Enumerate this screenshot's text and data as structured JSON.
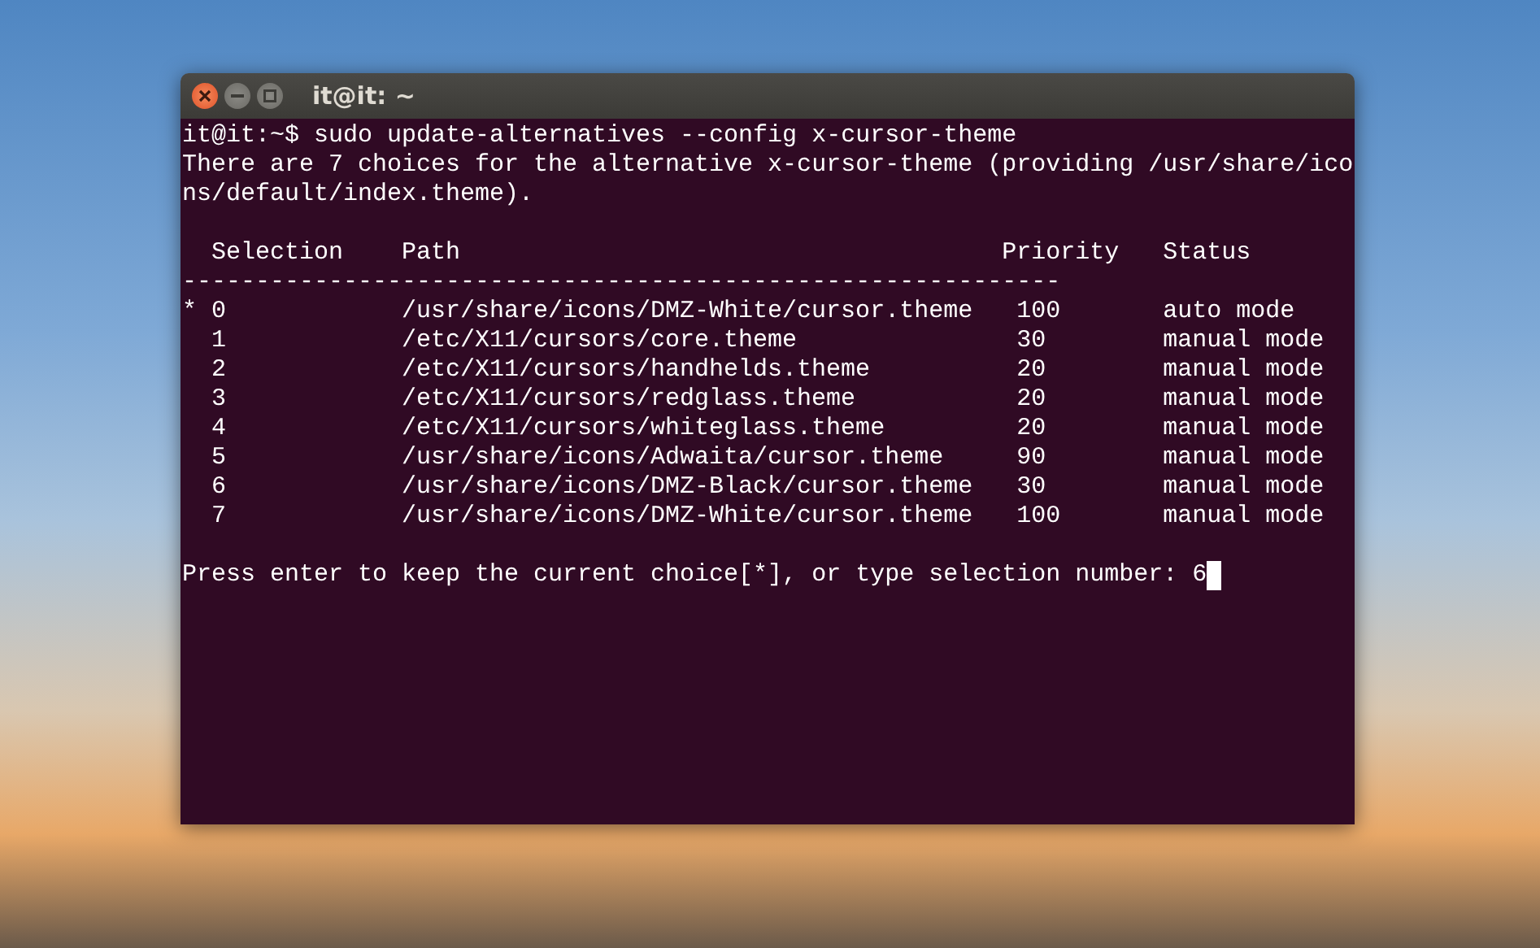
{
  "window": {
    "title": "it@it: ~"
  },
  "terminal": {
    "command_line": "it@it:~$ sudo update-alternatives --config x-cursor-theme",
    "output_lines": [
      "There are 7 choices for the alternative x-cursor-theme (providing /usr/share/ico",
      "ns/default/index.theme)."
    ],
    "table": {
      "columns": [
        "Selection",
        "Path",
        "Priority",
        "Status"
      ],
      "separator": "------------------------------------------------------------",
      "rows": [
        {
          "current_mark": "*",
          "selection": "0",
          "path": "/usr/share/icons/DMZ-White/cursor.theme",
          "priority": "100",
          "status": "auto mode"
        },
        {
          "selection": "1",
          "path": "/etc/X11/cursors/core.theme",
          "priority": "30",
          "status": "manual mode"
        },
        {
          "selection": "2",
          "path": "/etc/X11/cursors/handhelds.theme",
          "priority": "20",
          "status": "manual mode"
        },
        {
          "selection": "3",
          "path": "/etc/X11/cursors/redglass.theme",
          "priority": "20",
          "status": "manual mode"
        },
        {
          "selection": "4",
          "path": "/etc/X11/cursors/whiteglass.theme",
          "priority": "20",
          "status": "manual mode"
        },
        {
          "selection": "5",
          "path": "/usr/share/icons/Adwaita/cursor.theme",
          "priority": "90",
          "status": "manual mode"
        },
        {
          "selection": "6",
          "path": "/usr/share/icons/DMZ-Black/cursor.theme",
          "priority": "30",
          "status": "manual mode"
        },
        {
          "selection": "7",
          "path": "/usr/share/icons/DMZ-White/cursor.theme",
          "priority": "100",
          "status": "manual mode"
        }
      ]
    },
    "prompt": "Press enter to keep the current choice[*], or type selection number:",
    "input": "6"
  }
}
